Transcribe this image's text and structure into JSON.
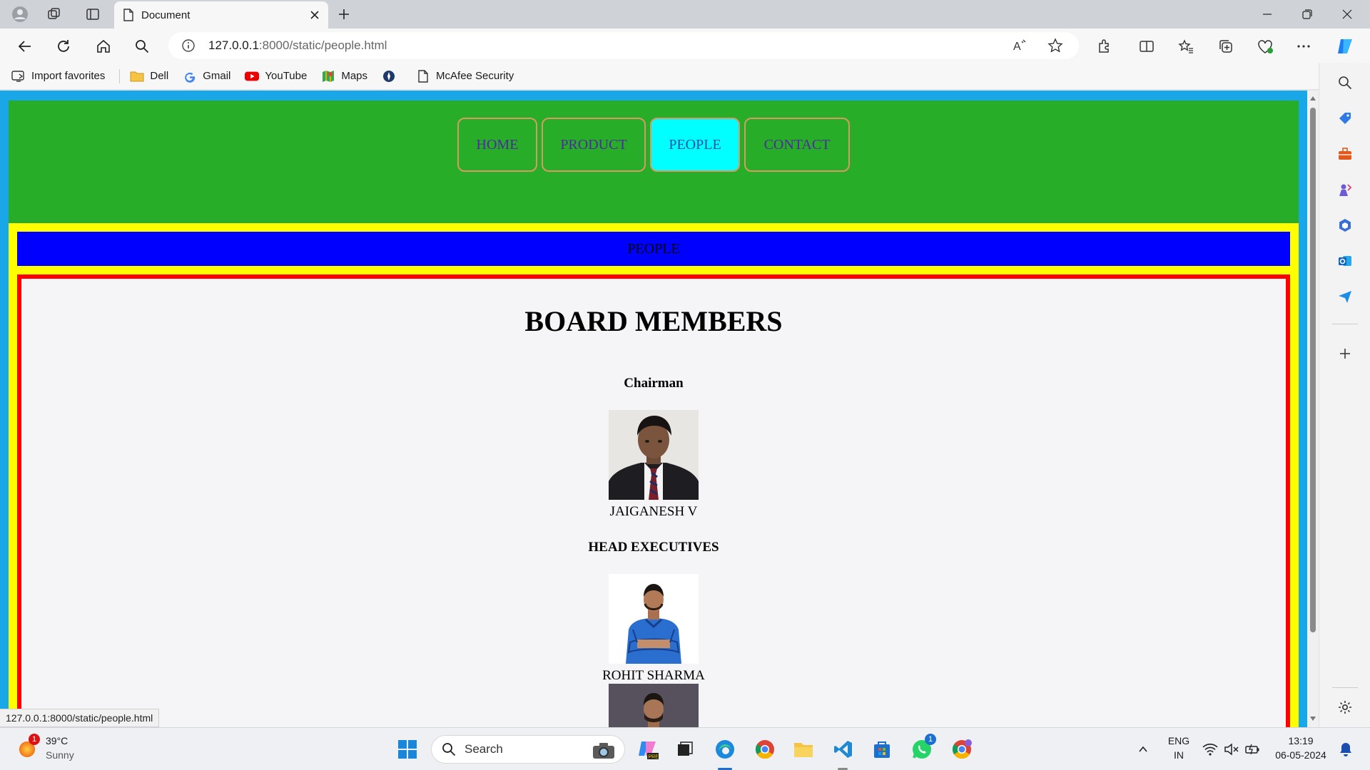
{
  "browser": {
    "tab_title": "Document",
    "url_host": "127.0.0.1",
    "url_path": ":8000/static/people.html",
    "status_url": "127.0.0.1:8000/static/people.html"
  },
  "favorites": [
    {
      "label": "Import favorites",
      "icon": "import-icon"
    },
    {
      "label": "Dell",
      "icon": "folder-icon"
    },
    {
      "label": "Gmail",
      "icon": "google-icon"
    },
    {
      "label": "YouTube",
      "icon": "youtube-icon"
    },
    {
      "label": "Maps",
      "icon": "maps-icon"
    },
    {
      "label": "",
      "icon": "compass-icon"
    },
    {
      "label": "McAfee Security",
      "icon": "page-icon"
    }
  ],
  "site": {
    "nav": [
      {
        "label": "HOME",
        "active": false
      },
      {
        "label": "PRODUCT",
        "active": false
      },
      {
        "label": "PEOPLE",
        "active": true
      },
      {
        "label": "CONTACT",
        "active": false
      }
    ],
    "section_title": "PEOPLE",
    "heading": "BOARD MEMBERS",
    "chairman_label": "Chairman",
    "chairman_name": "JAIGANESH V",
    "executives_label": "HEAD EXECUTIVES",
    "executive_1_name": "ROHIT SHARMA"
  },
  "taskbar": {
    "weather_temp": "39°C",
    "weather_cond": "Sunny",
    "weather_badge": "1",
    "search_placeholder": "Search",
    "whatsapp_badge": "1",
    "lang_1": "ENG",
    "lang_2": "IN",
    "time": "13:19",
    "date": "06-05-2024"
  },
  "colors": {
    "header_green": "#27ad27",
    "active_nav": "#00ffff",
    "band_yellow": "#ffff00",
    "bar_blue": "#0000ff",
    "frame_red": "#ff0000",
    "page_bg": "#1aa7e8"
  }
}
